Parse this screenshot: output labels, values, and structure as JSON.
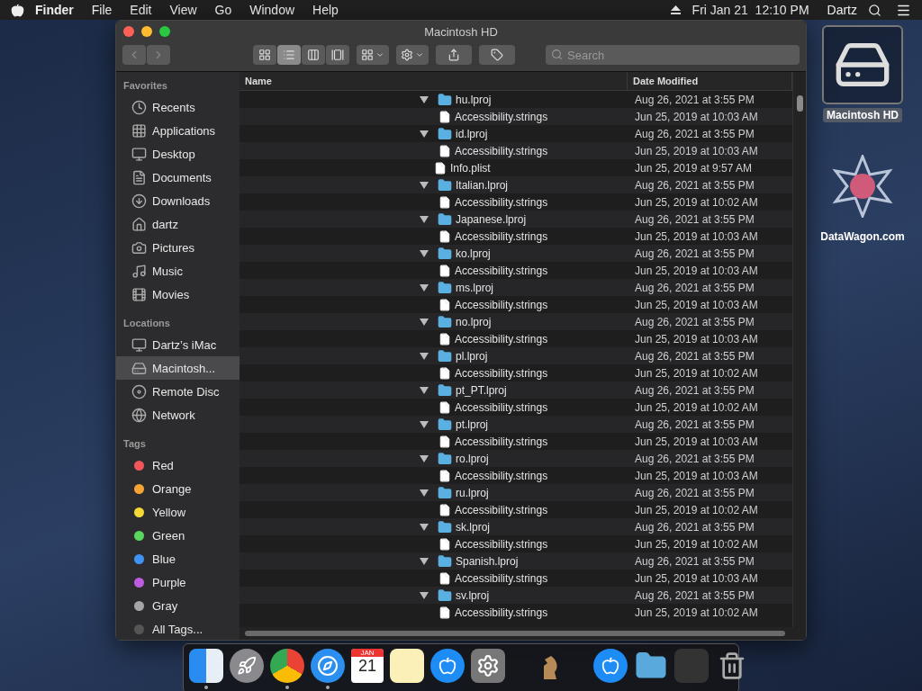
{
  "menubar": {
    "app": "Finder",
    "menus": [
      "File",
      "Edit",
      "View",
      "Go",
      "Window",
      "Help"
    ],
    "clock": "Fri Jan 21  12:10 PM",
    "user": "Dartz"
  },
  "window": {
    "title": "Macintosh HD"
  },
  "toolbar": {
    "views": [
      {
        "kind": "icons",
        "selected": false
      },
      {
        "kind": "list",
        "selected": true
      },
      {
        "kind": "columns",
        "selected": false
      },
      {
        "kind": "gallery",
        "selected": false
      }
    ],
    "search": {
      "placeholder": "Search"
    }
  },
  "sidebar": [
    {
      "title": "Favorites",
      "items": [
        {
          "label": "Recents",
          "selected": false
        },
        {
          "label": "Applications",
          "selected": false
        },
        {
          "label": "Desktop",
          "selected": false
        },
        {
          "label": "Documents",
          "selected": false
        },
        {
          "label": "Downloads",
          "selected": false
        },
        {
          "label": "dartz",
          "selected": false
        },
        {
          "label": "Pictures",
          "selected": false
        },
        {
          "label": "Music",
          "selected": false
        },
        {
          "label": "Movies",
          "selected": false
        }
      ]
    },
    {
      "title": "Locations",
      "items": [
        {
          "label": "Dartz’s iMac",
          "selected": false
        },
        {
          "label": "Macintosh...",
          "selected": true
        },
        {
          "label": "Remote Disc",
          "selected": false
        },
        {
          "label": "Network",
          "selected": false
        }
      ]
    },
    {
      "title": "Tags",
      "items": [
        {
          "label": "Red",
          "color": "#f0565a",
          "selected": false
        },
        {
          "label": "Orange",
          "color": "#f5a434",
          "selected": false
        },
        {
          "label": "Yellow",
          "color": "#f6d935",
          "selected": false
        },
        {
          "label": "Green",
          "color": "#5ad55f",
          "selected": false
        },
        {
          "label": "Blue",
          "color": "#3f93f5",
          "selected": false
        },
        {
          "label": "Purple",
          "color": "#bd5ce0",
          "selected": false
        },
        {
          "label": "Gray",
          "color": "#a5a5a8",
          "selected": false
        },
        {
          "label": "All Tags...",
          "selected": false
        }
      ]
    }
  ],
  "table": {
    "columns": [
      "Name",
      "Date Modified"
    ],
    "rows": [
      {
        "name": "hu.lproj",
        "date": "Aug 26, 2021 at 3:55 PM",
        "kind": "folder",
        "expanded": true,
        "children": [
          {
            "name": "Accessibility.strings",
            "date": "Jun 25, 2019 at 10:03 AM",
            "kind": "file"
          }
        ]
      },
      {
        "name": "id.lproj",
        "date": "Aug 26, 2021 at 3:55 PM",
        "kind": "folder",
        "expanded": true,
        "children": [
          {
            "name": "Accessibility.strings",
            "date": "Jun 25, 2019 at 10:03 AM",
            "kind": "file"
          }
        ]
      },
      {
        "name": "Info.plist",
        "date": "Jun 25, 2019 at 9:57 AM",
        "kind": "file"
      },
      {
        "name": "Italian.lproj",
        "date": "Aug 26, 2021 at 3:55 PM",
        "kind": "folder",
        "expanded": true,
        "children": [
          {
            "name": "Accessibility.strings",
            "date": "Jun 25, 2019 at 10:02 AM",
            "kind": "file"
          }
        ]
      },
      {
        "name": "Japanese.lproj",
        "date": "Aug 26, 2021 at 3:55 PM",
        "kind": "folder",
        "expanded": true,
        "children": [
          {
            "name": "Accessibility.strings",
            "date": "Jun 25, 2019 at 10:03 AM",
            "kind": "file"
          }
        ]
      },
      {
        "name": "ko.lproj",
        "date": "Aug 26, 2021 at 3:55 PM",
        "kind": "folder",
        "expanded": true,
        "children": [
          {
            "name": "Accessibility.strings",
            "date": "Jun 25, 2019 at 10:03 AM",
            "kind": "file"
          }
        ]
      },
      {
        "name": "ms.lproj",
        "date": "Aug 26, 2021 at 3:55 PM",
        "kind": "folder",
        "expanded": true,
        "children": [
          {
            "name": "Accessibility.strings",
            "date": "Jun 25, 2019 at 10:03 AM",
            "kind": "file"
          }
        ]
      },
      {
        "name": "no.lproj",
        "date": "Aug 26, 2021 at 3:55 PM",
        "kind": "folder",
        "expanded": true,
        "children": [
          {
            "name": "Accessibility.strings",
            "date": "Jun 25, 2019 at 10:03 AM",
            "kind": "file"
          }
        ]
      },
      {
        "name": "pl.lproj",
        "date": "Aug 26, 2021 at 3:55 PM",
        "kind": "folder",
        "expanded": true,
        "children": [
          {
            "name": "Accessibility.strings",
            "date": "Jun 25, 2019 at 10:02 AM",
            "kind": "file"
          }
        ]
      },
      {
        "name": "pt_PT.lproj",
        "date": "Aug 26, 2021 at 3:55 PM",
        "kind": "folder",
        "expanded": true,
        "children": [
          {
            "name": "Accessibility.strings",
            "date": "Jun 25, 2019 at 10:02 AM",
            "kind": "file"
          }
        ]
      },
      {
        "name": "pt.lproj",
        "date": "Aug 26, 2021 at 3:55 PM",
        "kind": "folder",
        "expanded": true,
        "children": [
          {
            "name": "Accessibility.strings",
            "date": "Jun 25, 2019 at 10:03 AM",
            "kind": "file"
          }
        ]
      },
      {
        "name": "ro.lproj",
        "date": "Aug 26, 2021 at 3:55 PM",
        "kind": "folder",
        "expanded": true,
        "children": [
          {
            "name": "Accessibility.strings",
            "date": "Jun 25, 2019 at 10:03 AM",
            "kind": "file"
          }
        ]
      },
      {
        "name": "ru.lproj",
        "date": "Aug 26, 2021 at 3:55 PM",
        "kind": "folder",
        "expanded": true,
        "children": [
          {
            "name": "Accessibility.strings",
            "date": "Jun 25, 2019 at 10:02 AM",
            "kind": "file"
          }
        ]
      },
      {
        "name": "sk.lproj",
        "date": "Aug 26, 2021 at 3:55 PM",
        "kind": "folder",
        "expanded": true,
        "children": [
          {
            "name": "Accessibility.strings",
            "date": "Jun 25, 2019 at 10:02 AM",
            "kind": "file"
          }
        ]
      },
      {
        "name": "Spanish.lproj",
        "date": "Aug 26, 2021 at 3:55 PM",
        "kind": "folder",
        "expanded": true,
        "children": [
          {
            "name": "Accessibility.strings",
            "date": "Jun 25, 2019 at 10:03 AM",
            "kind": "file"
          }
        ]
      },
      {
        "name": "sv.lproj",
        "date": "Aug 26, 2021 at 3:55 PM",
        "kind": "folder",
        "expanded": true,
        "children": [
          {
            "name": "Accessibility.strings",
            "date": "Jun 25, 2019 at 10:02 AM",
            "kind": "file"
          }
        ]
      }
    ]
  },
  "desktop_icons": [
    {
      "label": "Macintosh HD",
      "kind": "disk",
      "selected": true
    },
    {
      "label": "DataWagon.com",
      "kind": "star",
      "selected": false
    }
  ],
  "dock": [
    {
      "kind": "finder",
      "running": true
    },
    {
      "kind": "rocket",
      "running": false
    },
    {
      "kind": "chrome",
      "running": true
    },
    {
      "kind": "compass",
      "running": true
    },
    {
      "kind": "calendar",
      "running": false,
      "month": "JAN",
      "day": "21"
    },
    {
      "kind": "notes",
      "running": false
    },
    {
      "kind": "appstore",
      "running": false
    },
    {
      "kind": "gear",
      "running": false
    },
    {
      "kind": "divider"
    },
    {
      "kind": "chess",
      "running": false
    },
    {
      "kind": "divider"
    },
    {
      "kind": "appstore",
      "running": false
    },
    {
      "kind": "folder",
      "running": false
    },
    {
      "kind": "stack",
      "running": false
    },
    {
      "kind": "trash",
      "running": false
    }
  ]
}
